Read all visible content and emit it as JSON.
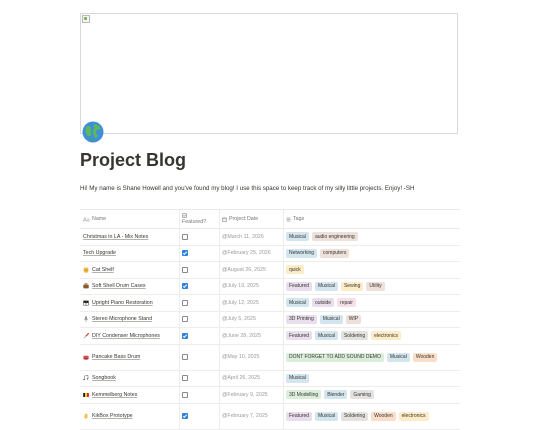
{
  "page": {
    "icon": "globe-icon",
    "title": "Project Blog",
    "intro": "Hi! My name is Shane Howell and you've found my blog! I use this space to keep track of my silly little projects. Enjoy! -SH"
  },
  "table": {
    "headers": {
      "name": "Name",
      "featured_line1": "Featured?",
      "date": "Project Date",
      "tags": "Tags"
    },
    "tag_colors": {
      "Musical": "#d3e5ef",
      "audio engineering": "#eee0da",
      "Networking": "#d3e5ef",
      "computers": "#eee0da",
      "quick": "#fdecc8",
      "Featured": "#e8deee",
      "Sewing": "#fdecc8",
      "Utility": "#eee0da",
      "outside": "#e8deee",
      "repair": "#f5e0e9",
      "3D Printing": "#e8deee",
      "WIP": "#eee0da",
      "Soldering": "#e3e2e0",
      "electronics": "#fdecc8",
      "DONT FORGET TO ADD SOUND DEMO": "#dbeddb",
      "Wooden": "#fadec9",
      "3D Modelling": "#dbeddb",
      "Blender": "#d3e5ef",
      "Gaming": "#e3e2e0"
    },
    "rows": [
      {
        "icon": "none",
        "name": "Christmas in LA - Mix Notes",
        "featured": false,
        "date": "@March 11, 2026",
        "tags": [
          "Musical",
          "audio engineering"
        ]
      },
      {
        "icon": "none",
        "name": "Tech Upgrade",
        "featured": true,
        "date": "@February 25, 2026",
        "tags": [
          "Networking",
          "computers"
        ]
      },
      {
        "icon": "cat-icon",
        "name": "Cat Shelf",
        "featured": false,
        "date": "@August 26, 2025",
        "tags": [
          "quick"
        ]
      },
      {
        "icon": "briefcase-icon",
        "name": "Soft Shell Drum Cases",
        "featured": true,
        "date": "@July 19, 2025",
        "tags": [
          "Featured",
          "Musical",
          "Sewing",
          "Utility"
        ]
      },
      {
        "icon": "piano-icon",
        "name": "Upright Piano Restoration",
        "featured": false,
        "date": "@July 12, 2025",
        "tags": [
          "Musical",
          "outside",
          "repair"
        ]
      },
      {
        "icon": "microphone-icon",
        "name": "Stereo Microphone Stand",
        "featured": false,
        "date": "@July 5, 2025",
        "tags": [
          "3D Printing",
          "Musical",
          "WIP"
        ]
      },
      {
        "icon": "screwdriver-icon",
        "name": "DIY Condenser Microphones",
        "featured": true,
        "date": "@June 28, 2025",
        "tags": [
          "Featured",
          "Musical",
          "Soldering",
          "electronics"
        ]
      },
      {
        "icon": "drum-icon",
        "name": "Pancake Bass Drum",
        "featured": false,
        "date": "@May 10, 2025",
        "tags": [
          "DONT FORGET TO ADD SOUND DEMO",
          "Musical",
          "Wooden"
        ]
      },
      {
        "icon": "music-notes-icon",
        "name": "Songbook",
        "featured": false,
        "date": "@April 26, 2025",
        "tags": [
          "Musical"
        ]
      },
      {
        "icon": "belgium-flag-icon",
        "name": "Kemmelberg Notes",
        "featured": false,
        "date": "@February 9, 2025",
        "tags": [
          "3D Modelling",
          "Blender",
          "Gaming"
        ]
      },
      {
        "icon": "hand-icon",
        "name": "KikBox Prototype",
        "featured": true,
        "date": "@February 7, 2025",
        "tags": [
          "Featured",
          "Musical",
          "Soldering",
          "Wooden",
          "electronics"
        ]
      }
    ]
  }
}
